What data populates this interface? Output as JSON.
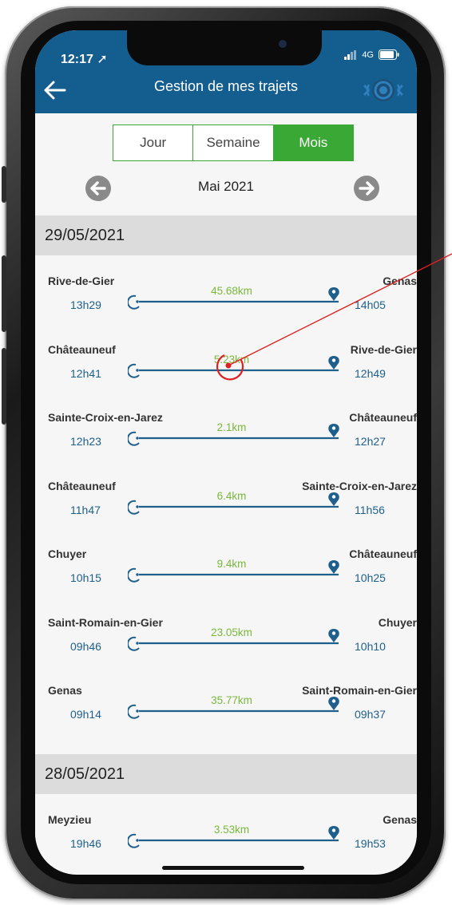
{
  "status": {
    "time": "12:17",
    "network": "4G"
  },
  "header": {
    "title": "Gestion de mes trajets",
    "back_icon": "back-arrow-icon",
    "logo_icon": "sensor-logo-icon"
  },
  "periods": {
    "day": "Jour",
    "week": "Semaine",
    "month": "Mois",
    "active": "Mois"
  },
  "month_label": "Mai 2021",
  "colors": {
    "header": "#145d8f",
    "accent": "#3aa834",
    "time": "#1e5f8c",
    "distance": "#7ab83c",
    "annotation": "#e02020"
  },
  "groups": [
    {
      "date": "29/05/2021",
      "trips": [
        {
          "from": "Rive-de-Gier",
          "to": "Genas",
          "start": "13h29",
          "end": "14h05",
          "distance": "45.68km"
        },
        {
          "from": "Châteauneuf",
          "to": "Rive-de-Gier",
          "start": "12h41",
          "end": "12h49",
          "distance": "5.23km"
        },
        {
          "from": "Sainte-Croix-en-Jarez",
          "to": "Châteauneuf",
          "start": "12h23",
          "end": "12h27",
          "distance": "2.1km"
        },
        {
          "from": "Châteauneuf",
          "to": "Sainte-Croix-en-Jarez",
          "start": "11h47",
          "end": "11h56",
          "distance": "6.4km"
        },
        {
          "from": "Chuyer",
          "to": "Châteauneuf",
          "start": "10h15",
          "end": "10h25",
          "distance": "9.4km"
        },
        {
          "from": "Saint-Romain-en-Gier",
          "to": "Chuyer",
          "start": "09h46",
          "end": "10h10",
          "distance": "23.05km"
        },
        {
          "from": "Genas",
          "to": "Saint-Romain-en-Gier",
          "start": "09h14",
          "end": "09h37",
          "distance": "35.77km"
        }
      ]
    },
    {
      "date": "28/05/2021",
      "trips": [
        {
          "from": "Meyzieu",
          "to": "Genas",
          "start": "19h46",
          "end": "19h53",
          "distance": "3.53km"
        }
      ]
    }
  ]
}
